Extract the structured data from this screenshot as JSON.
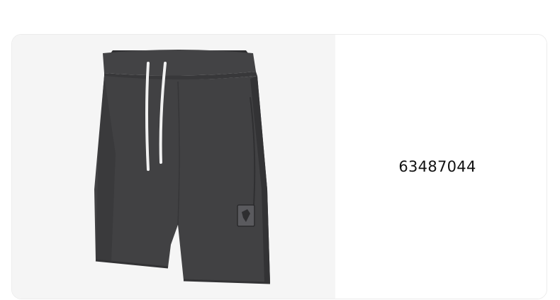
{
  "product": {
    "code": "63487044",
    "image_subject": "dark-grey-shorts",
    "colors": {
      "fabric": "#3e3e40",
      "drawstring": "#f1f1f1",
      "background": "#f5f5f5"
    }
  }
}
